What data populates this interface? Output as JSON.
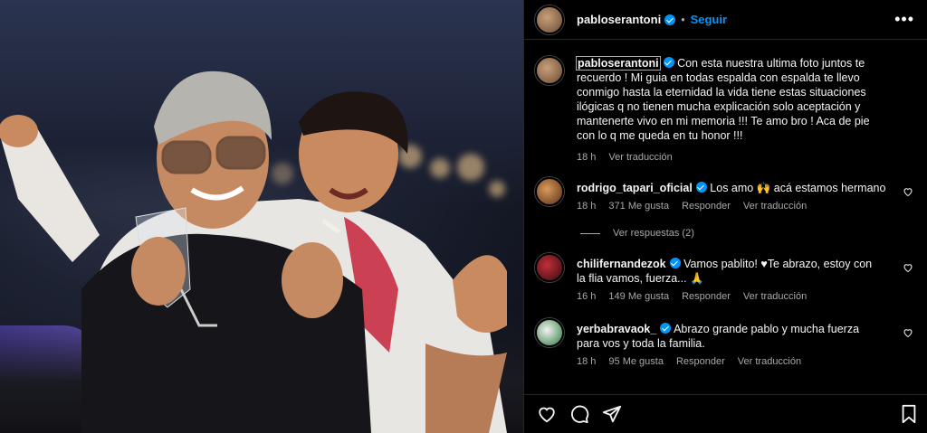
{
  "header": {
    "username": "pabloserantoni",
    "separator": "•",
    "follow_label": "Seguir",
    "more_label": "•••"
  },
  "caption": {
    "username": "pabloserantoni",
    "text": "Con esta nuestra ultima foto juntos te recuerdo ! Mi guia en todas espalda con espalda te llevo conmigo hasta la eternidad la vida tiene estas situaciones ilógicas q no tienen mucha explicación solo aceptación y mantenerte vivo en mi memoria !!! Te amo bro ! Aca de pie con lo q me queda en tu honor !!!",
    "time": "18 h",
    "translate_label": "Ver traducción"
  },
  "comments": [
    {
      "username": "rodrigo_tapari_oficial",
      "text": "Los amo 🙌 acá estamos hermano",
      "time": "18 h",
      "likes": "371 Me gusta",
      "reply_label": "Responder",
      "translate_label": "Ver traducción",
      "replies_label": "Ver respuestas (2)"
    },
    {
      "username": "chilifernandezok",
      "text": "Vamos pablito! ♥Te abrazo, estoy con la flia vamos, fuerza... 🙏",
      "time": "16 h",
      "likes": "149 Me gusta",
      "reply_label": "Responder",
      "translate_label": "Ver traducción"
    },
    {
      "username": "yerbabravaok_",
      "text": "Abrazo grande pablo y mucha fuerza para vos y toda la familia.",
      "time": "18 h",
      "likes": "95 Me gusta",
      "reply_label": "Responder",
      "translate_label": "Ver traducción"
    }
  ],
  "actions": [
    "heart-icon",
    "comment-icon",
    "share-icon",
    "save-icon"
  ],
  "colors": {
    "accent": "#0095f6",
    "background": "#000000",
    "secondary_text": "#a8a8a8"
  }
}
